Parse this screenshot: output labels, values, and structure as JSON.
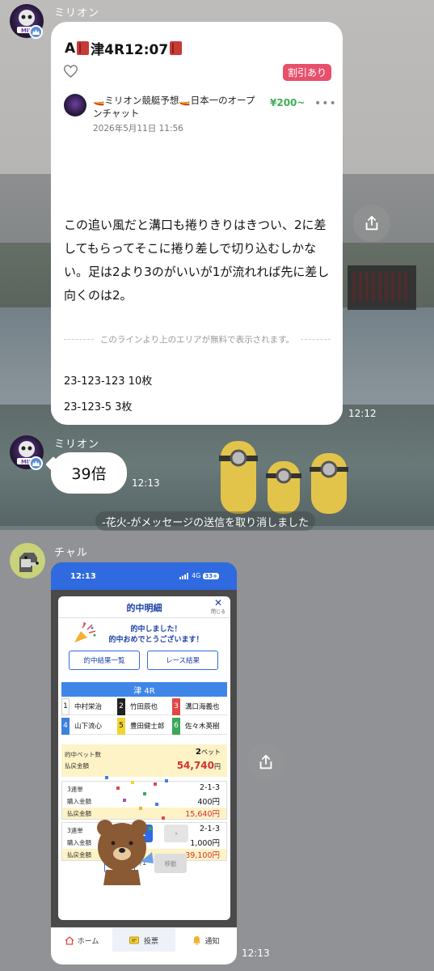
{
  "messages": {
    "sender1": "ミリオン",
    "card": {
      "title_prefix": "A",
      "title_main": "津4R12:07",
      "discount_badge": "割引あり",
      "author_name": "🚤ミリオン競艇予想🚤日本一のオープンチャット",
      "date": "2026年5月11日 11:56",
      "price": "¥200~",
      "more": "•••",
      "body": "この追い風だと溝口も捲りきりはきつい、2に差してもらってそこに捲り差しで切り込むしかない。足は2より3のがいいが1が流れれば先に差し向くのは2。",
      "free_notice": "このラインより上のエリアが無料で表示されます。",
      "bet1": "23-123-123  10枚",
      "bet2": "23-123-5  3枚"
    },
    "time1": "12:12",
    "sender2": "ミリオン",
    "bubble_text": "39倍",
    "time2": "12:13",
    "system_message": "-花火-がメッセージの送信を取り消しました",
    "sender3": "チャル",
    "time3": "12:13"
  },
  "screenshot": {
    "status_time": "12:13",
    "signal": "4G",
    "battery": "33+",
    "modal_title": "的中明細",
    "close_label": "閉じる",
    "congrats_line1": "的中しました！",
    "congrats_line2": "的中おめでとうございます！",
    "btn_list": "的中結果一覧",
    "btn_race": "レース結果",
    "race_name": "津 4R",
    "racers": [
      {
        "num": "1",
        "name": "中村栄治",
        "bg": "#ffffff",
        "fg": "#111111"
      },
      {
        "num": "2",
        "name": "竹田辰也",
        "bg": "#222222",
        "fg": "#ffffff"
      },
      {
        "num": "3",
        "name": "溝口海義也",
        "bg": "#e04848",
        "fg": "#ffffff"
      },
      {
        "num": "4",
        "name": "山下流心",
        "bg": "#3f7fe0",
        "fg": "#ffffff"
      },
      {
        "num": "5",
        "name": "豊田健士郎",
        "bg": "#f2d431",
        "fg": "#111111"
      },
      {
        "num": "6",
        "name": "佐々木英樹",
        "bg": "#3aa85a",
        "fg": "#ffffff"
      }
    ],
    "hit_count_label": "的中ベット数",
    "hit_count": "2",
    "hit_count_unit": "ベット",
    "payout_label": "払戻金額",
    "payout_total": "54,740",
    "yen": "円",
    "bets": [
      {
        "type": "3連単",
        "combo": "2-1-3",
        "buy_label": "購入金額",
        "buy": "400円",
        "pay_label": "払戻金額",
        "pay": "15,640円"
      },
      {
        "type": "3連単",
        "combo": "2-1-3",
        "buy_label": "購入金額",
        "buy": "1,000円",
        "pay_label": "払戻金額",
        "pay": "39,100円"
      }
    ],
    "pager_prev": "‹",
    "pager_current": "1",
    "pager_next": "›",
    "page_of": "/1",
    "move_btn": "移動",
    "tabs": [
      {
        "label": "ホーム"
      },
      {
        "label": "投票"
      },
      {
        "label": "通知"
      }
    ]
  },
  "colors": {
    "line_green": "#3fae5a",
    "accent_blue": "#2f6ae0",
    "badge_pink": "#e7506b"
  },
  "icons": [
    "share-icon",
    "heart-icon",
    "crown-icon",
    "home-icon",
    "vote-icon",
    "bell-icon"
  ]
}
